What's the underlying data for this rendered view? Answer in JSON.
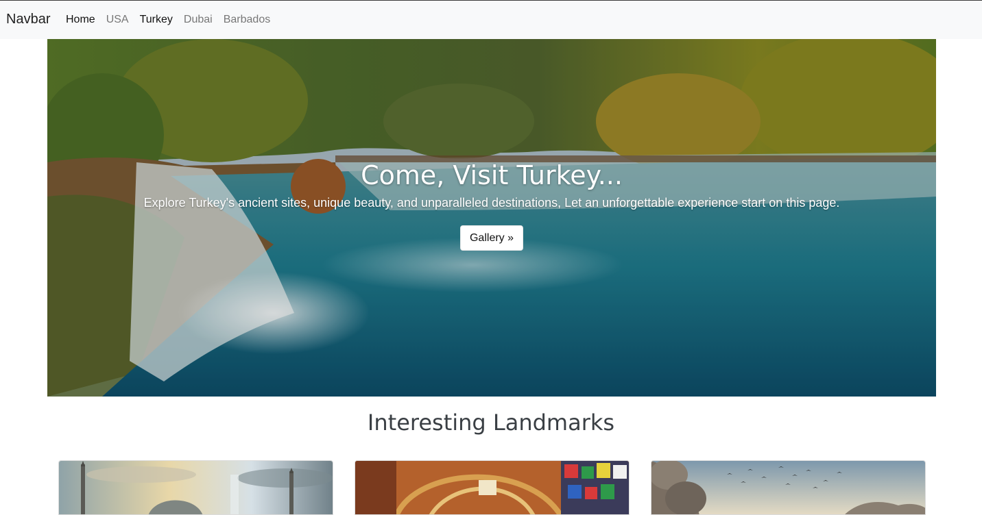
{
  "navbar": {
    "brand": "Navbar",
    "links": [
      {
        "label": "Home",
        "active": true
      },
      {
        "label": "USA",
        "active": false
      },
      {
        "label": "Turkey",
        "active": true
      },
      {
        "label": "Dubai",
        "active": false
      },
      {
        "label": "Barbados",
        "active": false
      }
    ]
  },
  "hero": {
    "title": "Come, Visit Turkey...",
    "subtitle": "Explore Turkey's ancient sites, unique beauty, and unparalleled destinations, Let an unforgettable experience start on this page.",
    "button_label": "Gallery »"
  },
  "landmarks": {
    "heading": "Interesting Landmarks",
    "cards": [
      {
        "image": "mosque-skyline"
      },
      {
        "image": "grand-bazaar"
      },
      {
        "image": "rock-formations-birds"
      }
    ]
  }
}
